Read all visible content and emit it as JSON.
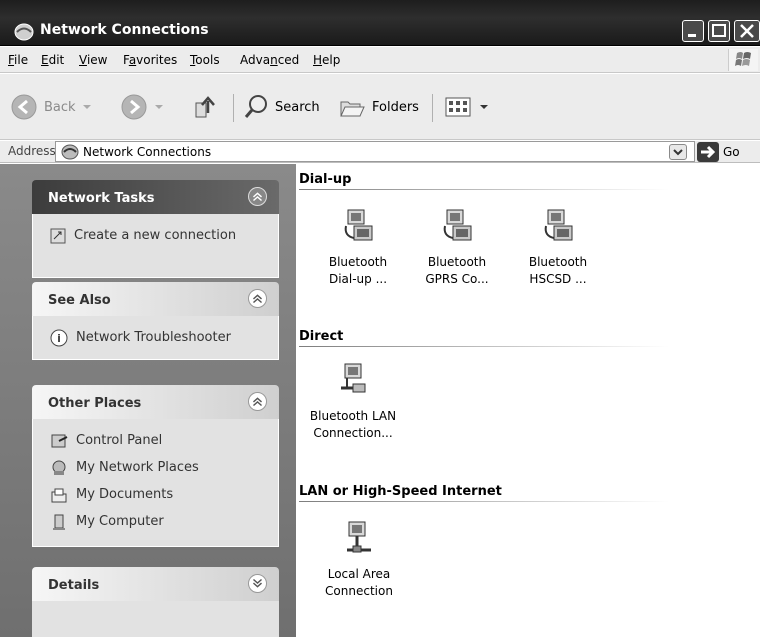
{
  "window": {
    "title": "Network Connections"
  },
  "menu": [
    {
      "pre": "",
      "ul": "F",
      "post": "ile"
    },
    {
      "pre": "",
      "ul": "E",
      "post": "dit"
    },
    {
      "pre": "",
      "ul": "V",
      "post": "iew"
    },
    {
      "pre": "F",
      "ul": "a",
      "post": "vorites"
    },
    {
      "pre": "",
      "ul": "T",
      "post": "ools"
    },
    {
      "pre": "Adva",
      "ul": "n",
      "post": "ced"
    },
    {
      "pre": "",
      "ul": "H",
      "post": "elp"
    }
  ],
  "toolbar": {
    "back": "Back",
    "search": "Search",
    "folders": "Folders"
  },
  "address": {
    "label": "Address",
    "value": "Network Connections",
    "go": "Go"
  },
  "tasks": {
    "network_tasks": {
      "title": "Network Tasks",
      "items": [
        "Create a new connection"
      ]
    },
    "see_also": {
      "title": "See Also",
      "items": [
        "Network Troubleshooter"
      ]
    },
    "other_places": {
      "title": "Other Places",
      "items": [
        "Control Panel",
        "My Network Places",
        "My Documents",
        "My Computer"
      ]
    },
    "details": {
      "title": "Details"
    }
  },
  "groups": {
    "dialup": {
      "title": "Dial-up",
      "items": [
        {
          "line1": "Bluetooth",
          "line2": "Dial-up ..."
        },
        {
          "line1": "Bluetooth",
          "line2": "GPRS Co..."
        },
        {
          "line1": "Bluetooth",
          "line2": "HSCSD ..."
        }
      ]
    },
    "direct": {
      "title": "Direct",
      "items": [
        {
          "line1": "Bluetooth LAN",
          "line2": "Connection..."
        }
      ]
    },
    "lan": {
      "title": "LAN or High-Speed Internet",
      "items": [
        {
          "line1": "Local Area",
          "line2": "Connection"
        }
      ]
    }
  }
}
